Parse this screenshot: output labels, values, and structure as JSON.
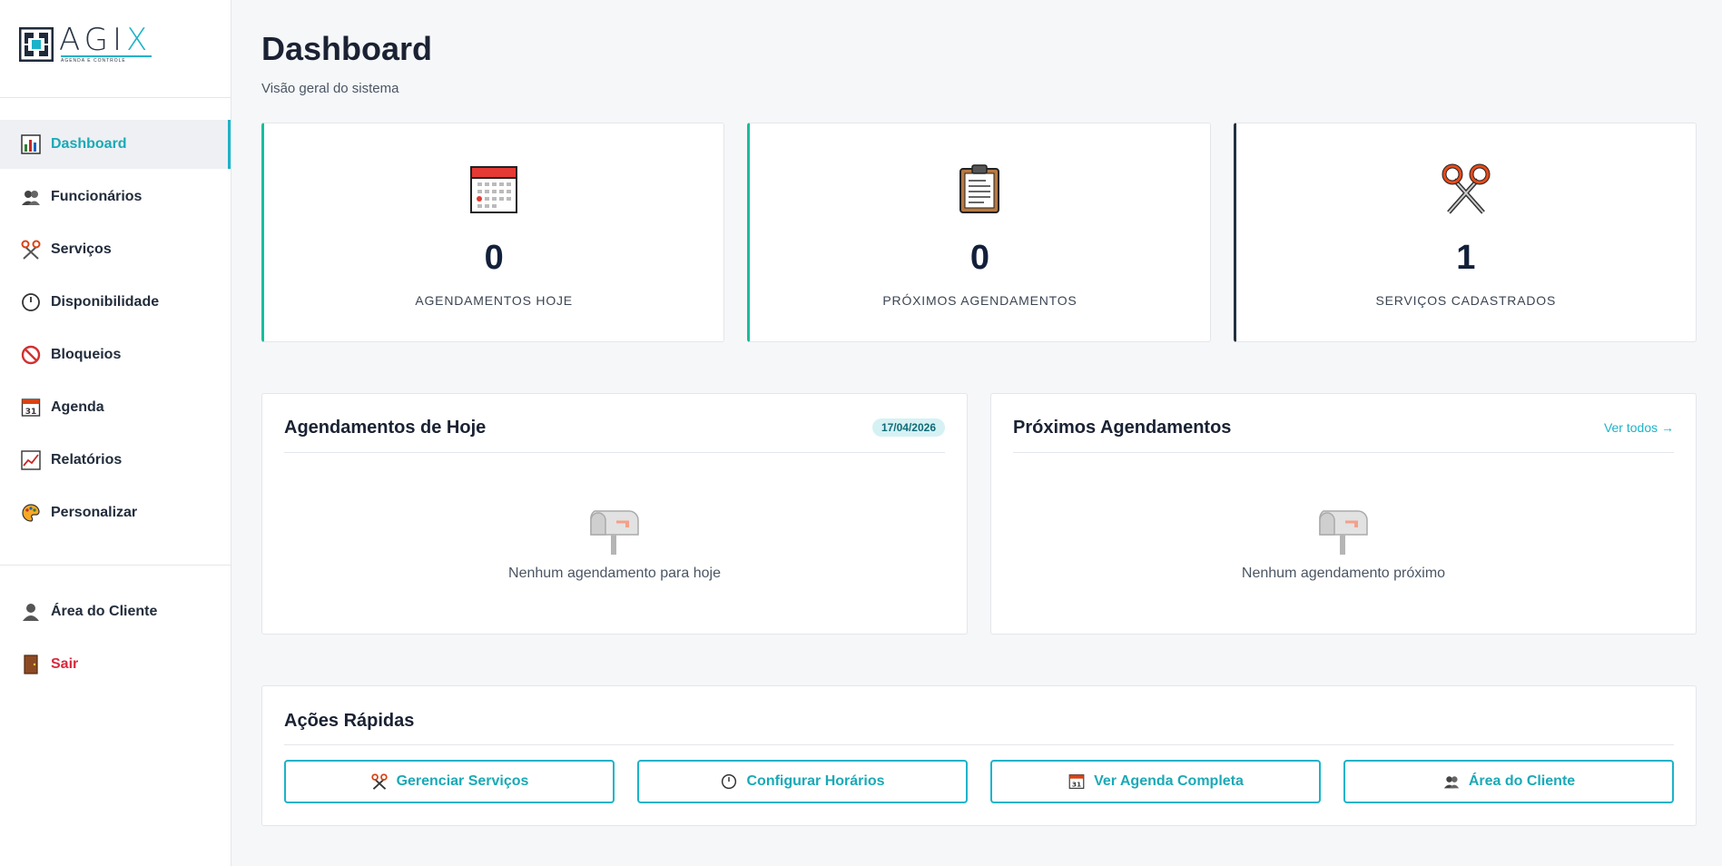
{
  "brand": {
    "name_main": "AGI",
    "name_accent": "X",
    "tagline": "AGENDA E CONTROLE",
    "accent_color": "#1bb3c9"
  },
  "sidebar": {
    "items": [
      {
        "label": "Dashboard",
        "icon": "bar-chart-icon",
        "active": true
      },
      {
        "label": "Funcionários",
        "icon": "people-icon"
      },
      {
        "label": "Serviços",
        "icon": "scissors-icon"
      },
      {
        "label": "Disponibilidade",
        "icon": "clock-icon"
      },
      {
        "label": "Bloqueios",
        "icon": "prohibited-icon"
      },
      {
        "label": "Agenda",
        "icon": "calendar-icon"
      },
      {
        "label": "Relatórios",
        "icon": "line-chart-icon"
      },
      {
        "label": "Personalizar",
        "icon": "palette-icon"
      }
    ],
    "bottom_items": [
      {
        "label": "Área do Cliente",
        "icon": "client-icon"
      },
      {
        "label": "Sair",
        "icon": "door-icon"
      }
    ]
  },
  "header": {
    "title": "Dashboard",
    "subtitle": "Visão geral do sistema"
  },
  "stats": [
    {
      "value": "0",
      "label": "AGENDAMENTOS HOJE",
      "icon": "calendar-icon"
    },
    {
      "value": "0",
      "label": "PRÓXIMOS AGENDAMENTOS",
      "icon": "clipboard-icon"
    },
    {
      "value": "1",
      "label": "SERVIÇOS CADASTRADOS",
      "icon": "scissors-icon"
    }
  ],
  "today_panel": {
    "title": "Agendamentos de Hoje",
    "date": "17/04/2026",
    "empty_text": "Nenhum agendamento para hoje"
  },
  "upcoming_panel": {
    "title": "Próximos Agendamentos",
    "link": "Ver todos →",
    "empty_text": "Nenhum agendamento próximo"
  },
  "quick_actions": {
    "title": "Ações Rápidas",
    "buttons": [
      {
        "label": "Gerenciar Serviços",
        "icon": "scissors-icon"
      },
      {
        "label": "Configurar Horários",
        "icon": "clock-icon"
      },
      {
        "label": "Ver Agenda Completa",
        "icon": "calendar-icon"
      },
      {
        "label": "Área do Cliente",
        "icon": "people-icon"
      }
    ]
  }
}
